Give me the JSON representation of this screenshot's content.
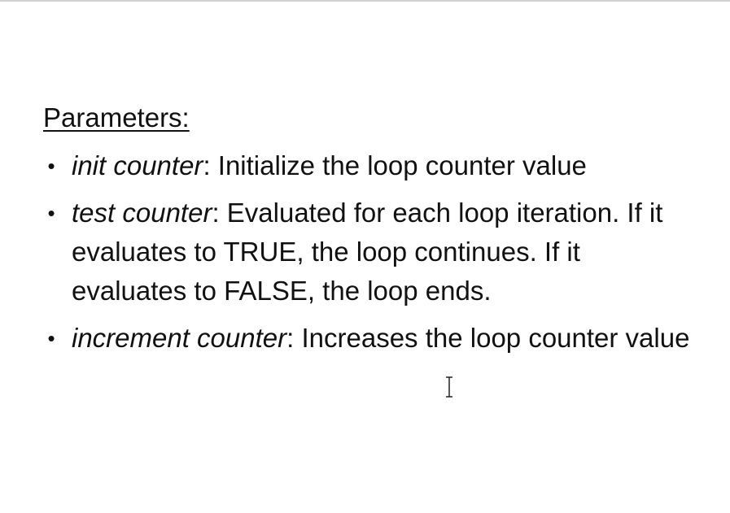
{
  "slide": {
    "heading": "Parameters:",
    "bullets": [
      {
        "term": "init counter",
        "separator": ":",
        "description": " Initialize the loop counter value"
      },
      {
        "term": "test counter",
        "separator": ":",
        "description": " Evaluated for each loop iteration. If it evaluates to TRUE, the loop continues. If it evaluates to FALSE, the loop ends."
      },
      {
        "term": "increment counter",
        "separator": ":",
        "description": " Increases the loop counter value"
      }
    ],
    "bullet_glyph": "•"
  },
  "icons": {
    "cursor": "text-cursor-icon"
  },
  "colors": {
    "background": "#ffffff",
    "text": "#111111",
    "top_rule": "#d0d0d0"
  }
}
